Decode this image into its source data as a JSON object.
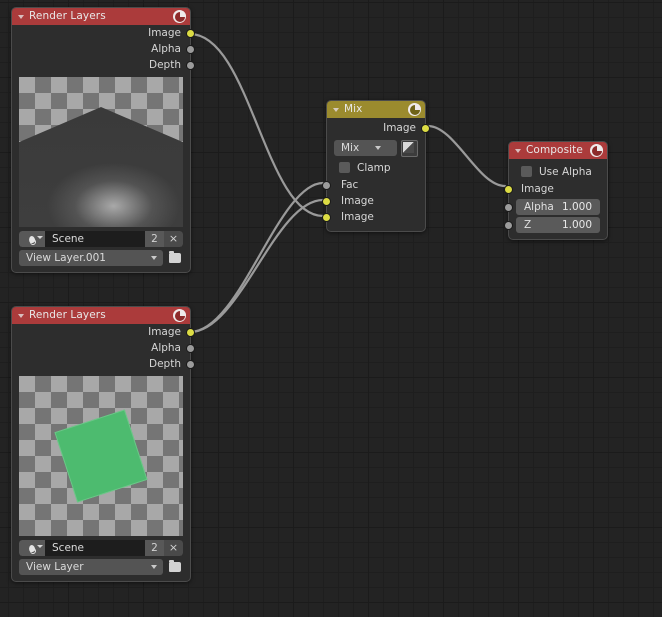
{
  "editor": {
    "name": "blender-compositor-node-editor",
    "background_color": "#232323",
    "grid_line_color": "#1e1e1e"
  },
  "nodes": [
    {
      "id": "render-layers-1",
      "title": "Render Layers",
      "header_color": "#ab3b3b",
      "header_icon": "scene-render-icon",
      "collapse_icon": "triangle-down-icon",
      "outputs": [
        {
          "label": "Image",
          "color": "#dcdc44"
        },
        {
          "label": "Alpha",
          "color": "#9b9b9b"
        },
        {
          "label": "Depth",
          "color": "#9b9b9b"
        }
      ],
      "preview": "render-preview-plane",
      "scene": {
        "value": "Scene",
        "users": "2",
        "close_label": "×",
        "icon": "scene-data-icon"
      },
      "view_layer": {
        "value": "View Layer.001",
        "new_icon": "new-viewlayer-icon"
      }
    },
    {
      "id": "mix",
      "title": "Mix",
      "header_color": "#9b8b2e",
      "header_icon": "node-icon",
      "collapse_icon": "triangle-down-icon",
      "outputs": [
        {
          "label": "Image",
          "color": "#dcdc44"
        }
      ],
      "blend_mode": {
        "value": "Mix"
      },
      "alpha_toggle_icon": "use-alpha-icon",
      "clamp": {
        "label": "Clamp",
        "checked": false
      },
      "inputs": [
        {
          "label": "Fac",
          "color": "#9b9b9b"
        },
        {
          "label": "Image",
          "color": "#dcdc44"
        },
        {
          "label": "Image",
          "color": "#dcdc44"
        }
      ]
    },
    {
      "id": "composite",
      "title": "Composite",
      "header_color": "#ab3b3b",
      "header_icon": "composite-icon",
      "collapse_icon": "triangle-down-icon",
      "use_alpha": {
        "label": "Use Alpha",
        "checked": false
      },
      "inputs": [
        {
          "label": "Image",
          "color": "#dcdc44",
          "type": "socket"
        },
        {
          "label": "Alpha",
          "color": "#9b9b9b",
          "type": "value",
          "value": "1.000"
        },
        {
          "label": "Z",
          "color": "#9b9b9b",
          "type": "value",
          "value": "1.000"
        }
      ]
    },
    {
      "id": "render-layers-2",
      "title": "Render Layers",
      "header_color": "#ab3b3b",
      "header_icon": "scene-render-icon",
      "collapse_icon": "triangle-down-icon",
      "outputs": [
        {
          "label": "Image",
          "color": "#dcdc44"
        },
        {
          "label": "Alpha",
          "color": "#9b9b9b"
        },
        {
          "label": "Depth",
          "color": "#9b9b9b"
        }
      ],
      "preview": "render-preview-cube",
      "scene": {
        "value": "Scene",
        "users": "2",
        "close_label": "×",
        "icon": "scene-data-icon"
      },
      "view_layer": {
        "value": "View Layer",
        "new_icon": "new-viewlayer-icon"
      }
    }
  ],
  "links": [
    {
      "from": "render-layers-1.Image",
      "to": "mix.Image.2"
    },
    {
      "from": "render-layers-2.Image",
      "to": "mix.Image.1"
    },
    {
      "from": "render-layers-2.Image",
      "to": "mix.Fac"
    },
    {
      "from": "mix.Image",
      "to": "composite.Image"
    }
  ]
}
